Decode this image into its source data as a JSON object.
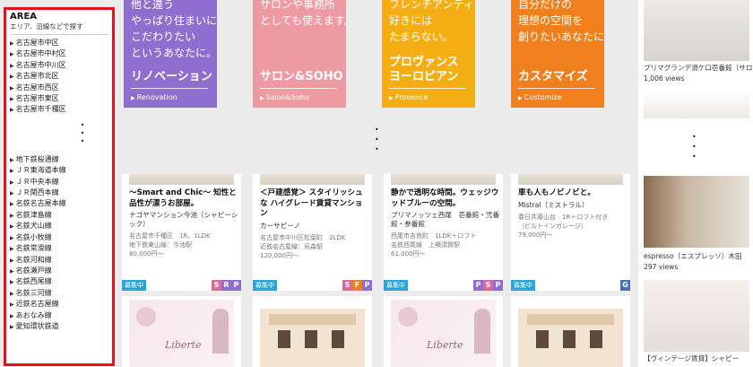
{
  "sidebar": {
    "title": "AREA",
    "subtitle": "エリア、沿線などで探す",
    "areas": [
      "名古屋市中区",
      "名古屋市中村区",
      "名古屋市中川区",
      "名古屋市北区",
      "名古屋市西区",
      "名古屋市東区",
      "名古屋市千種区"
    ],
    "lines": [
      "地下鉄桜通線",
      "ＪＲ東海道本線",
      "ＪＲ中央本線",
      "ＪＲ関西本線",
      "名鉄名古屋本線",
      "名鉄津島線",
      "名鉄犬山線",
      "名鉄小牧線",
      "名鉄常滑線",
      "名鉄河和線",
      "名鉄瀬戸線",
      "名鉄西尾線",
      "名鉄三河線",
      "近鉄名古屋線",
      "あおなみ線",
      "愛知環状鉄道"
    ]
  },
  "banners": [
    {
      "lines": [
        "他と違う",
        "やっぱり住まいには",
        "こだわりたい",
        "というあなたに。"
      ],
      "title": "リノベーション",
      "sub": "Renovation",
      "color": "#8e6fcf"
    },
    {
      "lines": [
        "サロンや事務所",
        "としても使えます。"
      ],
      "title": "サロン&SOHO",
      "sub": "Salon&Soho",
      "color": "#ee9aa3"
    },
    {
      "lines": [
        "フレンチアンティークが",
        "好きには",
        "たまらない。"
      ],
      "title": "プロヴァンス\nヨーロピアン",
      "sub": "Provence",
      "color": "#f4ae14"
    },
    {
      "lines": [
        "自分だけの",
        "理想の空間を",
        "創りたいあなたに。"
      ],
      "title": "カスタマイズ",
      "sub": "Customize",
      "color": "#f0801e"
    }
  ],
  "listings": [
    {
      "title": "〜Smart and Chic〜 知性と品性が漂うお部屋。",
      "name": "ナゴヤマンション今池（シャピーシック）",
      "info": [
        "名古屋市千種区　1R、1LDK",
        "地下鉄東山線：今池駅",
        "80,000円〜"
      ],
      "badge": "募集中",
      "tags": [
        "S",
        "R",
        "P"
      ]
    },
    {
      "title": "＜戸建感覚＞ スタイリッシュな ハイグレード賃貸マンション",
      "name": "カーサピーノ",
      "info": [
        "名古屋市中川区松葉町　2LDK",
        "近鉄名古屋線：烏森駅",
        "120,000円〜"
      ],
      "badge": "募集中",
      "tags": [
        "S",
        "F",
        "P"
      ]
    },
    {
      "title": "静かで透明な時間。ウェッジウッドブルーの空間。",
      "name": "プリマノッツェ西尾　壱番館・弐番館・参番館",
      "info": [
        "西尾市吉良町　1LDK＋ロフト",
        "名鉄西尾線　上横須賀駅",
        "61,000円〜"
      ],
      "badge": "募集中",
      "tags": [
        "P",
        "S",
        "P"
      ]
    },
    {
      "title": "車も人もノビノビと。",
      "name": "Mistral（ミストラル）",
      "info": [
        "春日井藤山台　1R＋ロフト付き",
        "（ビルトインガレージ）",
        "79,000円〜"
      ],
      "badge": "募集中",
      "tags": [
        "G"
      ]
    }
  ],
  "right_column": [
    {
      "caption": "プリマグランデ須ケ口壱番館（サロン）",
      "views": "1,006 views"
    },
    {
      "caption": "espresso（エスプレッソ）木田",
      "views": "297 views"
    },
    {
      "caption": "【ヴィンテージ賃貸】シャピー"
    }
  ],
  "promo_text": "Liberte",
  "colors": {
    "sidebar_border": "#e8101a",
    "badge": "#29a5d8",
    "tag_s": "#d86b9a",
    "tag_r": "#8e6fcf",
    "tag_p": "#8e6fcf",
    "tag_f": "#f0801e",
    "tag_g": "#4a6fb8"
  }
}
